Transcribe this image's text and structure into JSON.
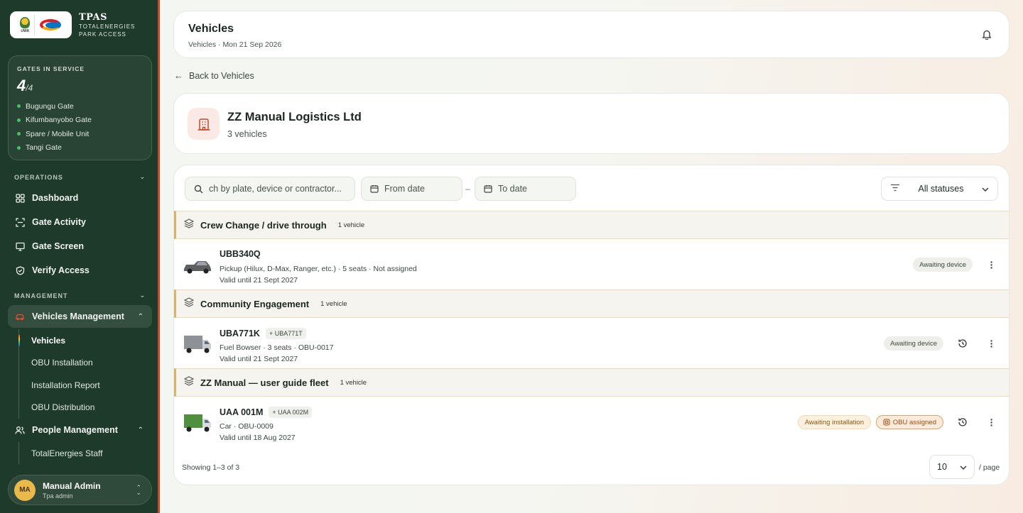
{
  "brand": {
    "title": "TPAS",
    "subtitle_line1": "TOTALENERGIES",
    "subtitle_line2": "PARK ACCESS",
    "uwa_caption": "UWA"
  },
  "gates": {
    "label": "GATES IN SERVICE",
    "active": "4",
    "total": "/4",
    "items": [
      "Bugungu Gate",
      "Kifumbanyobo Gate",
      "Spare / Mobile Unit",
      "Tangi Gate"
    ],
    "status_color": "#4bbf6b"
  },
  "nav": {
    "operations_label": "OPERATIONS",
    "management_label": "MANAGEMENT",
    "operations": [
      {
        "label": "Dashboard",
        "icon": "grid-icon"
      },
      {
        "label": "Gate Activity",
        "icon": "scan-icon"
      },
      {
        "label": "Gate Screen",
        "icon": "monitor-icon"
      },
      {
        "label": "Verify Access",
        "icon": "shield-check-icon"
      }
    ],
    "vehicles_management": "Vehicles Management",
    "vehicles_sub": [
      "Vehicles",
      "OBU Installation",
      "Installation Report",
      "OBU Distribution"
    ],
    "people_management": "People Management",
    "people_sub": [
      "TotalEnergies Staff"
    ]
  },
  "user": {
    "initials": "MA",
    "name": "Manual Admin",
    "role": "Tpa admin"
  },
  "header": {
    "title": "Vehicles",
    "subtitle": "Vehicles · Mon 21 Sep 2026"
  },
  "back_label": "Back to Vehicles",
  "company": {
    "name": "ZZ Manual Logistics Ltd",
    "count": "3 vehicles"
  },
  "filters": {
    "search_placeholder": "ch by plate, device or contractor...",
    "from_placeholder": "From date",
    "to_placeholder": "To date",
    "status_value": "All statuses"
  },
  "groups": [
    {
      "title": "Crew Change / drive through",
      "count": "1 vehicle",
      "vehicle": {
        "plate": "UBB340Q",
        "alt_plate": "",
        "details": "Pickup (Hilux, D-Max, Ranger, etc.) · 5 seats · Not assigned",
        "valid": "Valid until 21 Sept 2027",
        "badges": [
          "Awaiting device"
        ]
      }
    },
    {
      "title": "Community Engagement",
      "count": "1 vehicle",
      "vehicle": {
        "plate": "UBA771K",
        "alt_plate": "+ UBA771T",
        "details": "Fuel Bowser · 3 seats · OBU-0017",
        "valid": "Valid until 21 Sept 2027",
        "badges": [
          "Awaiting device"
        ]
      }
    },
    {
      "title": "ZZ Manual — user guide fleet",
      "count": "1 vehicle",
      "vehicle": {
        "plate": "UAA 001M",
        "alt_plate": "+ UAA 002M",
        "details": "Car · OBU-0009",
        "valid": "Valid until 18 Aug 2027",
        "badges": [
          "Awaiting installation",
          "OBU assigned"
        ]
      }
    }
  ],
  "footer": {
    "showing": "Showing 1–3 of 3",
    "page_size": "10",
    "per_page": "/ page"
  },
  "colors": {
    "sidebar": "#1e3a2b",
    "accent": "#c44a2e",
    "group_border": "#d8b46a"
  }
}
